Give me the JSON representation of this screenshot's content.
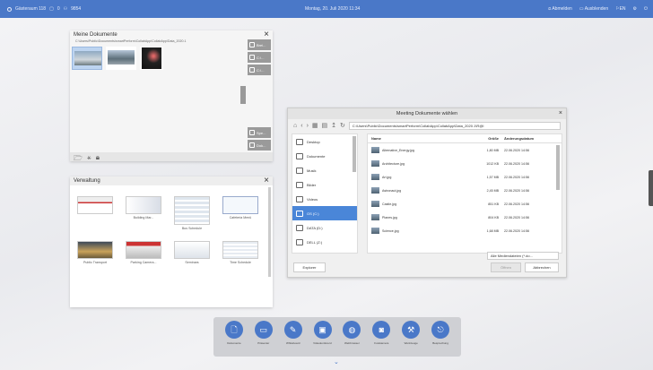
{
  "topbar": {
    "room": "Gästeraum 118",
    "devices": "0",
    "users": "9854",
    "datetime": "Montag, 20. Juli 2020 11:34",
    "logout_label": "Abmelden",
    "share_label": "Ausblenden",
    "language": "EN",
    "bg_color": "#4a78c8"
  },
  "docs_panel": {
    "title": "Meine Dokumente",
    "path": "C:\\Users\\Public\\Documents\\smartPerform\\CollabApp\\CollabApp\\Data_2020.1",
    "side_buttons": [
      "Brei...",
      "C:\\...",
      "C:\\..."
    ],
    "side_buttons2": [
      "Spe...",
      "Dok..."
    ]
  },
  "verwaltung_panel": {
    "title": "Verwaltung",
    "tiles": [
      {
        "caption": ""
      },
      {
        "caption": "Building Mar..."
      },
      {
        "caption": "Bus Schedule"
      },
      {
        "caption": "Cafeteria Menü"
      },
      {
        "caption": "Public Transport"
      },
      {
        "caption": "Parking Camera..."
      },
      {
        "caption": "Seminars"
      },
      {
        "caption": "Time Schedule"
      }
    ]
  },
  "dialog": {
    "title": "Meeting Dokumente wählen",
    "path": "C:\\Users\\Public\\Documents\\smartPerform\\CollabApp\\CollabApp\\Data_2020.1\\R@I",
    "places": [
      "Desktop",
      "Dokumente",
      "Musik",
      "Bilder",
      "Videos",
      "OS (C:)",
      "DATA (D:)",
      "DELL (Z:)"
    ],
    "columns": {
      "name": "Name",
      "size": "Größe",
      "date": "Änderungsdatum"
    },
    "files": [
      {
        "name": "Alternative_Energy.jpg",
        "size": "1,80 MB",
        "date": "22.06.2020 14:56"
      },
      {
        "name": "Architecture.jpg",
        "size": "1012 KB",
        "date": "22.06.2020 14:56"
      },
      {
        "name": "Art.jpg",
        "size": "1,57 MB",
        "date": "22.06.2020 14:56"
      },
      {
        "name": "Astronaut.jpg",
        "size": "2,45 MB",
        "date": "22.06.2020 14:56"
      },
      {
        "name": "Castle.jpg",
        "size": "851 KB",
        "date": "22.06.2020 14:56"
      },
      {
        "name": "Planes.jpg",
        "size": "804 KB",
        "date": "22.06.2020 14:56"
      },
      {
        "name": "Science.jpg",
        "size": "1,68 MB",
        "date": "22.06.2020 14:56"
      }
    ],
    "filter": "Alle Mediendateien (*.do...",
    "explore_label": "Explorer",
    "ok_label": "Öffnen",
    "cancel_label": "Abbrechen"
  },
  "dock": {
    "items": [
      {
        "label": "Dokumente",
        "icon": "document-icon"
      },
      {
        "label": "Präsenter",
        "icon": "screen-icon"
      },
      {
        "label": "Whiteboard",
        "icon": "pen-icon"
      },
      {
        "label": "Videokonferenz",
        "icon": "video-icon"
      },
      {
        "label": "Webbrowser",
        "icon": "globe-icon"
      },
      {
        "label": "Fotokamera",
        "icon": "camera-icon"
      },
      {
        "label": "Werkzeuge",
        "icon": "wrench-icon"
      },
      {
        "label": "Besprechung",
        "icon": "exit-icon"
      }
    ]
  }
}
